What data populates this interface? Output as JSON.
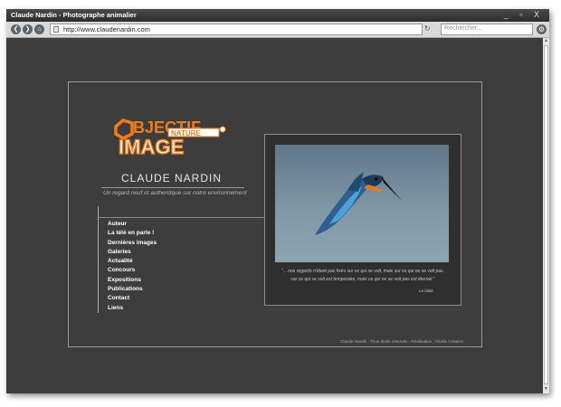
{
  "window": {
    "title": "Claude Nardin - Photographe animalier",
    "controls": "_ ▫ X"
  },
  "toolbar": {
    "url": "http://www.claudenardin.com",
    "search_placeholder": "Rechercher..."
  },
  "logo": {
    "line1": "BJECTIF",
    "badge": "NATURE",
    "line2": "IMAGE"
  },
  "header": {
    "name": "CLAUDE NARDIN",
    "tagline": "Un regard neuf et authentique sur notre environnement"
  },
  "nav": {
    "items": [
      "Auteur",
      "La télé en parle !",
      "Dernières images",
      "Galeries",
      "Actualité",
      "Concours",
      "Expositions",
      "Publications",
      "Contact",
      "Liens"
    ]
  },
  "quote": {
    "line1": "\"... nos regards n'étant pas fixés sur ce qui se voit, mais sur ce qui ne se voit pas,",
    "line2": "car ce qui se voit est temporaire, mais ce qui ne se voit pas est éternel.\"",
    "source": "La bible"
  },
  "footer": {
    "text": "Claude Nardin - Tous droits réservés - Réalisation : Ocelis Création"
  },
  "colors": {
    "page_bg": "#3d3d3d",
    "logo_orange": "#f07d1a",
    "logo_dark": "#4a2a0c"
  }
}
